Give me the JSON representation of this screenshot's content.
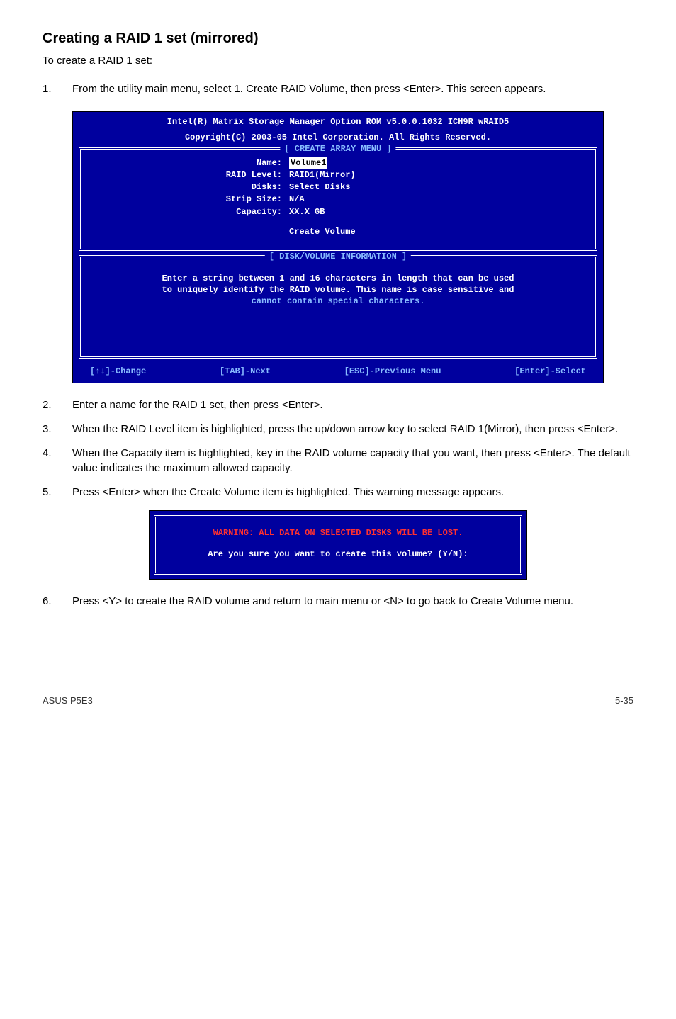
{
  "heading": "Creating a RAID 1 set (mirrored)",
  "intro": "To create a RAID 1 set:",
  "steps": {
    "s1": "From the utility main menu, select 1. Create RAID Volume, then press <Enter>. This screen appears.",
    "s2": "Enter a name for the RAID 1 set, then press <Enter>.",
    "s3": "When the RAID Level item is highlighted, press the up/down arrow key to select RAID 1(Mirror), then press <Enter>.",
    "s4": "When the Capacity item is highlighted, key in the RAID volume capacity that you want, then press <Enter>. The default value indicates the maximum allowed capacity.",
    "s5": "Press <Enter> when the Create Volume item is highlighted. This warning message appears.",
    "s6": "Press <Y> to create the RAID volume and return to main menu or <N> to go back to Create Volume menu."
  },
  "bios": {
    "header1": "Intel(R) Matrix Storage Manager Option ROM v5.0.0.1032 ICH9R wRAID5",
    "header2": "Copyright(C) 2003-05 Intel Corporation. All Rights Reserved.",
    "panel1_title": "[ CREATE ARRAY MENU ]",
    "fields": {
      "name_label": "Name:",
      "name_value": "Volume1",
      "raid_label": "RAID Level:",
      "raid_value": "RAID1(Mirror)",
      "disks_label": "Disks:",
      "disks_value": "Select Disks",
      "strip_label": "Strip Size:",
      "strip_value": "N/A",
      "cap_label": "Capacity:",
      "cap_value": "XX.X  GB",
      "create_label": "Create Volume"
    },
    "panel2_title": "[ DISK/VOLUME INFORMATION ]",
    "help1": "Enter a string between 1 and 16 characters in length that can be used",
    "help2": "to uniquely identify the RAID volume. This name is case sensitive and",
    "help3": "cannot contain special characters.",
    "footer": {
      "f1": "[↑↓]-Change",
      "f2": "[TAB]-Next",
      "f3": "[ESC]-Previous Menu",
      "f4": "[Enter]-Select"
    }
  },
  "warn": {
    "red": "WARNING: ALL DATA ON SELECTED DISKS WILL BE LOST.",
    "white": "Are you sure you want to create this volume? (Y/N):"
  },
  "footer": {
    "left": "ASUS P5E3",
    "right": "5-35"
  }
}
